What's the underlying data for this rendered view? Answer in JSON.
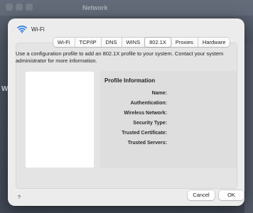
{
  "background": {
    "window_title": "Network",
    "side_text": "W"
  },
  "sheet": {
    "title": "Wi-Fi",
    "icon": "wifi-icon"
  },
  "tabs": [
    {
      "label": "Wi-Fi",
      "active": false
    },
    {
      "label": "TCP/IP",
      "active": false
    },
    {
      "label": "DNS",
      "active": false
    },
    {
      "label": "WINS",
      "active": false
    },
    {
      "label": "802.1X",
      "active": true
    },
    {
      "label": "Proxies",
      "active": false
    },
    {
      "label": "Hardware",
      "active": false
    }
  ],
  "description": "Use a configuration profile to add an 802.1X profile to your system. Contact your system administrator for more information.",
  "profile_info": {
    "title": "Profile Information",
    "fields": [
      {
        "label": "Name:",
        "value": ""
      },
      {
        "label": "Authentication:",
        "value": ""
      },
      {
        "label": "Wireless Network:",
        "value": ""
      },
      {
        "label": "Security Type:",
        "value": ""
      },
      {
        "label": "Trusted Certificate:",
        "value": ""
      },
      {
        "label": "Trusted Servers:",
        "value": ""
      }
    ]
  },
  "footer": {
    "help": "?",
    "cancel": "Cancel",
    "ok": "OK"
  },
  "colors": {
    "sheet_bg": "#ececec",
    "panel_bg": "#e4e4e4",
    "info_bg": "#dedede"
  }
}
